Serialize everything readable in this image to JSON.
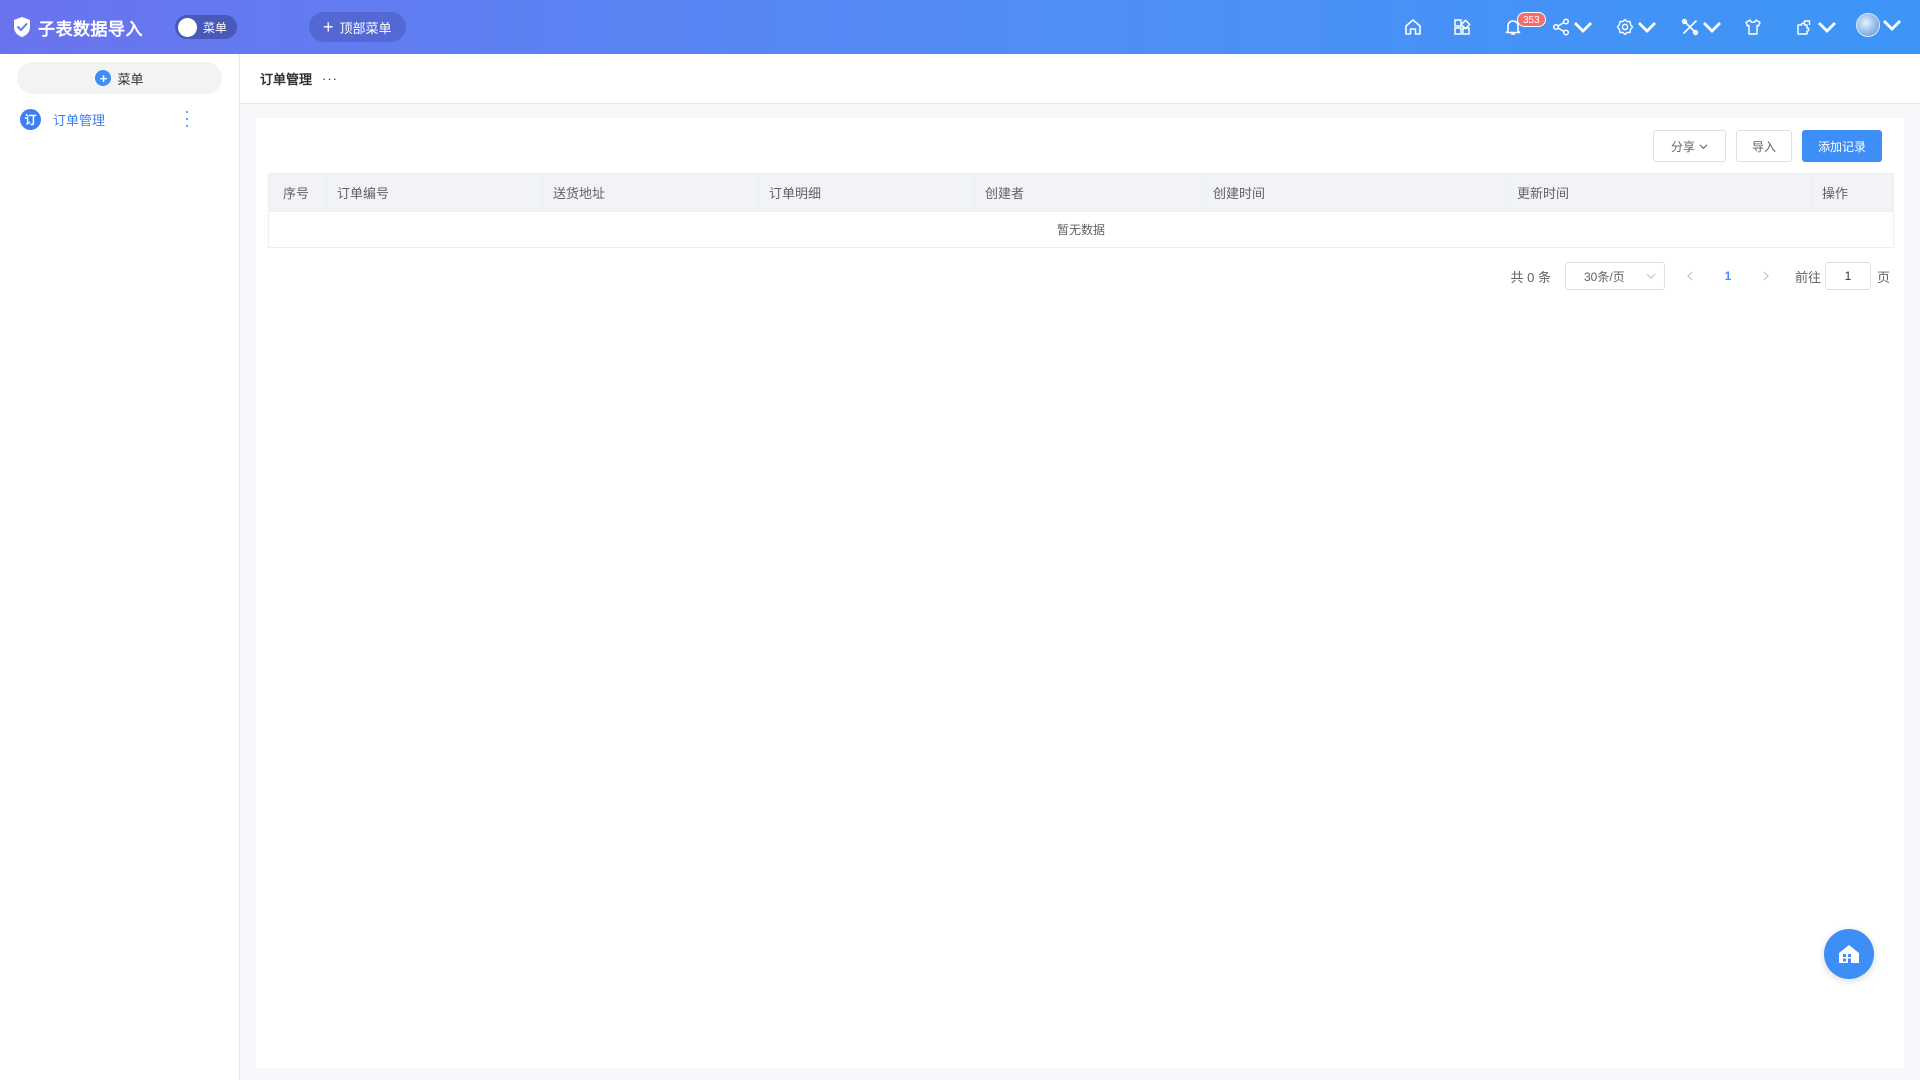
{
  "app": {
    "title": "子表数据导入",
    "menu_toggle_label": "菜单",
    "top_menu_label": "顶部菜单"
  },
  "header": {
    "notification_count": "353",
    "icons": [
      "home-icon",
      "apps-icon",
      "bell-icon",
      "share-icon",
      "gear-icon",
      "tools-icon",
      "shirt-icon",
      "plugin-icon",
      "avatar"
    ]
  },
  "sidebar": {
    "add_label": "菜单",
    "items": [
      {
        "icon_text": "订",
        "label": "订单管理"
      }
    ]
  },
  "breadcrumb": {
    "title": "订单管理",
    "more": "···"
  },
  "toolbar": {
    "share_label": "分享",
    "import_label": "导入",
    "add_label": "添加记录"
  },
  "table": {
    "columns": [
      "序号",
      "订单编号",
      "送货地址",
      "订单明细",
      "创建者",
      "创建时间",
      "更新时间",
      "操作"
    ],
    "empty_text": "暂无数据"
  },
  "pagination": {
    "total_text": "共 0 条",
    "page_size": "30条/页",
    "current_page": "1",
    "goto_label": "前往",
    "goto_value": "1",
    "page_unit": "页"
  },
  "colors": {
    "primary": "#3d8ef7",
    "header_gradient_start": "#6a73ee",
    "header_gradient_end": "#3d95f6",
    "badge": "#f56c6c"
  }
}
